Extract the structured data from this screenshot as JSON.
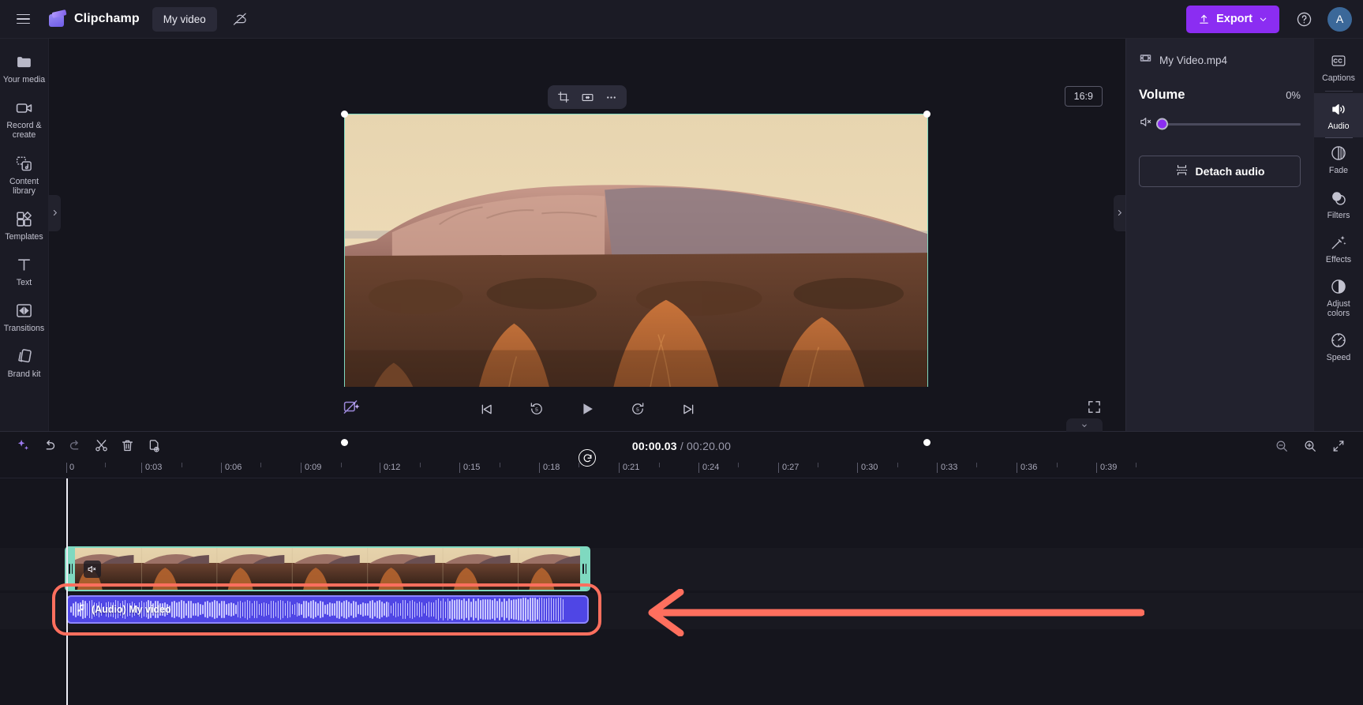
{
  "header": {
    "menu_icon": "hamburger-icon",
    "brand": "Clipchamp",
    "project_name": "My video",
    "cloud_icon": "cloud-off-icon",
    "export_label": "Export",
    "help_icon": "help-circle-icon",
    "avatar_initial": "A"
  },
  "sidebar": {
    "items": [
      {
        "icon": "folder-icon",
        "label": "Your media"
      },
      {
        "icon": "video-camera-icon",
        "label": "Record & create"
      },
      {
        "icon": "content-library-icon",
        "label": "Content library"
      },
      {
        "icon": "templates-icon",
        "label": "Templates"
      },
      {
        "icon": "text-icon",
        "label": "Text"
      },
      {
        "icon": "transitions-icon",
        "label": "Transitions"
      },
      {
        "icon": "brand-kit-icon",
        "label": "Brand kit"
      }
    ]
  },
  "stage": {
    "float_toolbar": [
      {
        "icon": "crop-icon",
        "label": "Crop"
      },
      {
        "icon": "fit-width-icon",
        "label": "Fit"
      },
      {
        "icon": "more-options-icon",
        "label": "More"
      }
    ],
    "aspect_ratio": "16:9",
    "rotate_icon": "rotate-icon",
    "magic_icon": "auto-compose-off-icon",
    "fullscreen_icon": "fullscreen-icon",
    "playback": [
      {
        "icon": "skip-start-icon"
      },
      {
        "icon": "back-5-icon"
      },
      {
        "icon": "play-icon"
      },
      {
        "icon": "forward-5-icon"
      },
      {
        "icon": "skip-end-icon"
      }
    ]
  },
  "properties": {
    "file_icon": "film-icon",
    "file_name": "My Video.mp4",
    "volume_label": "Volume",
    "volume_value": "0%",
    "mute_icon": "speaker-mute-icon",
    "detach_label": "Detach audio",
    "detach_icon": "detach-audio-icon"
  },
  "right_rail": {
    "items": [
      {
        "icon": "captions-icon",
        "label": "Captions",
        "active": false
      },
      {
        "icon": "audio-icon",
        "label": "Audio",
        "active": true
      },
      {
        "icon": "fade-icon",
        "label": "Fade",
        "active": false
      },
      {
        "icon": "filters-icon",
        "label": "Filters",
        "active": false
      },
      {
        "icon": "effects-icon",
        "label": "Effects",
        "active": false
      },
      {
        "icon": "adjust-colors-icon",
        "label": "Adjust colors",
        "active": false
      },
      {
        "icon": "speed-icon",
        "label": "Speed",
        "active": false
      }
    ]
  },
  "timeline": {
    "toolbar": [
      {
        "icon": "sparkle-ai-icon",
        "label": "AI tools"
      },
      {
        "icon": "undo-icon",
        "label": "Undo"
      },
      {
        "icon": "redo-icon",
        "label": "Redo"
      },
      {
        "icon": "split-scissors-icon",
        "label": "Split"
      },
      {
        "icon": "delete-trash-icon",
        "label": "Delete"
      },
      {
        "icon": "duplicate-icon",
        "label": "Duplicate"
      }
    ],
    "current_time": "00:00.03",
    "time_separator": "/",
    "total_time": "00:20.00",
    "zoom_controls": [
      {
        "icon": "zoom-out-icon",
        "label": "Zoom out"
      },
      {
        "icon": "zoom-in-icon",
        "label": "Zoom in"
      },
      {
        "icon": "fit-timeline-icon",
        "label": "Fit to timeline"
      }
    ],
    "ruler_labels": [
      "0",
      "0:03",
      "0:06",
      "0:09",
      "0:12",
      "0:15",
      "0:18",
      "0:21",
      "0:24",
      "0:27",
      "0:30",
      "0:33",
      "0:36",
      "0:39"
    ],
    "video_clip": {
      "mute_icon": "speaker-mute-icon"
    },
    "audio_clip": {
      "icon": "music-note-icon",
      "label": "(Audio) My video"
    }
  },
  "annotation": {
    "color": "#ff6f5e",
    "shape": "arrow-left",
    "highlight": "audio-track-highlight"
  }
}
